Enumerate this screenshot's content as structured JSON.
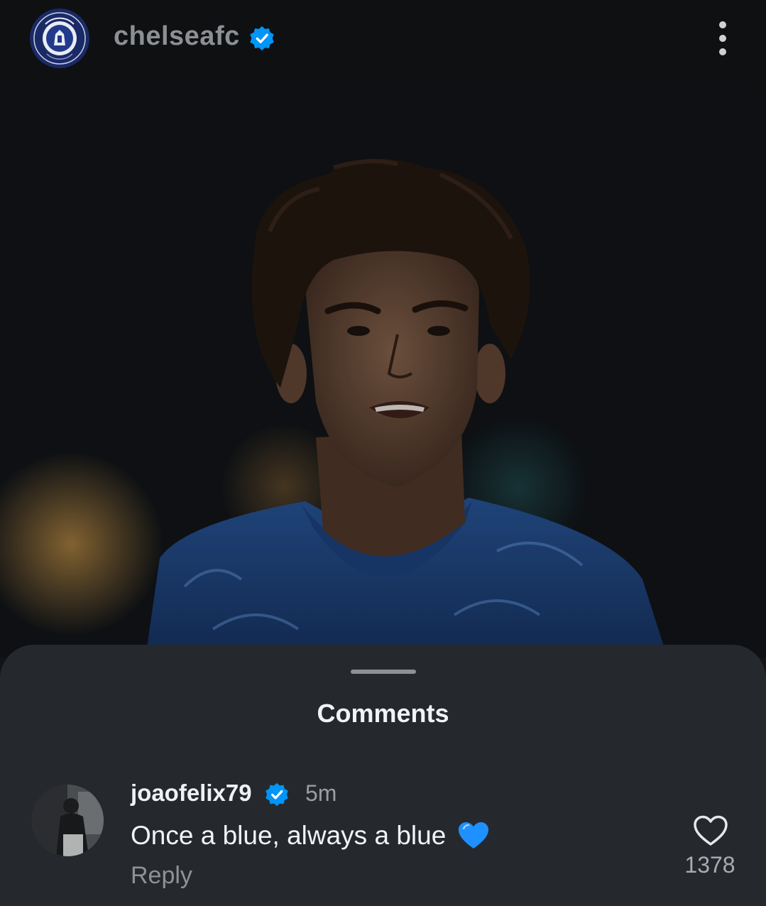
{
  "post": {
    "username": "chelseafc",
    "verified": true
  },
  "comments_sheet": {
    "title": "Comments",
    "comments": [
      {
        "username": "joaofelix79",
        "verified": true,
        "time": "5m",
        "text": "Once a blue, always a blue",
        "emoji": "blue-heart",
        "reply_label": "Reply",
        "likes": "1378"
      }
    ]
  },
  "icons": {
    "more": "more-vertical-icon",
    "verified": "verified-badge-icon",
    "like": "heart-outline-icon",
    "emoji": "blue-heart-emoji"
  },
  "colors": {
    "verified_blue": "#0095f6",
    "sheet_bg": "#25292e",
    "header_bg": "#0f1012",
    "jersey_blue": "#1d3f75"
  }
}
